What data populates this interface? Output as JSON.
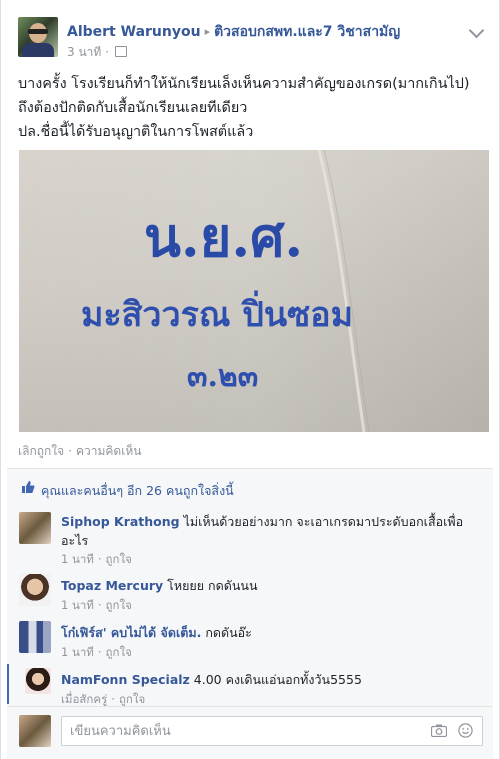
{
  "post": {
    "author": "Albert Warunyou",
    "separator": "▸",
    "group": "ติวสอบกสพท.และ7 วิชาสามัญ",
    "time": "3 นาที",
    "meta_dot": "·",
    "text_lines": [
      "บางครั้ง โรงเรียนก็ทำให้นักเรียนเล็งเห็นความสำคัญของเกรด(มากเกินไป)",
      "ถึงต้องปักติดกับเสื้อนักเรียนเลยทีเดียว",
      "ปล.ชื่อนี้ได้รับอนุญาติในการโพสต์แล้ว"
    ],
    "image_text": [
      "น.ย.ศ.",
      "มะสิววรณ ปิ่นซอม",
      "๓.๒๓"
    ],
    "unlike": "เลิกถูกใจ",
    "action_dot": "·",
    "comment_action": "ความคิดเห็น"
  },
  "likes": {
    "text": "คุณและคนอื่นๆ อีก 26 คนถูกใจสิ่งนี้"
  },
  "comments": [
    {
      "name": "Siphop Krathong",
      "text": "ไม่เห็นด้วยอย่างมาก จะเอาเกรดมาประดับอกเสื้อเพื่ออะไร",
      "time": "1 นาที",
      "like": "ถูกใจ"
    },
    {
      "name": "Topaz Mercury",
      "text": "โหยยย กดดันนน",
      "time": "1 นาที",
      "like": "ถูกใจ"
    },
    {
      "name": "โก๋เฟิร์ส' คบไม่ได้ จัดเต็ม.",
      "text": "กดดันอ๊ะ",
      "time": "1 นาที",
      "like": "ถูกใจ"
    },
    {
      "name": "NamFonn Specialz",
      "text": "4.00 คงเดินแอ่นอกทั้งวัน5555",
      "time": "เมื่อสักครู่",
      "like": "ถูกใจ"
    }
  ],
  "composer": {
    "placeholder": "เขียนความคิดเห็น"
  },
  "colors": {
    "link": "#365899",
    "meta": "#90949c",
    "embroidery": "#2a4aa8",
    "accent": "#4267b2"
  },
  "icons": [
    "chevron-down-icon",
    "audience-icon",
    "like-thumb-icon",
    "camera-icon",
    "smile-icon"
  ]
}
